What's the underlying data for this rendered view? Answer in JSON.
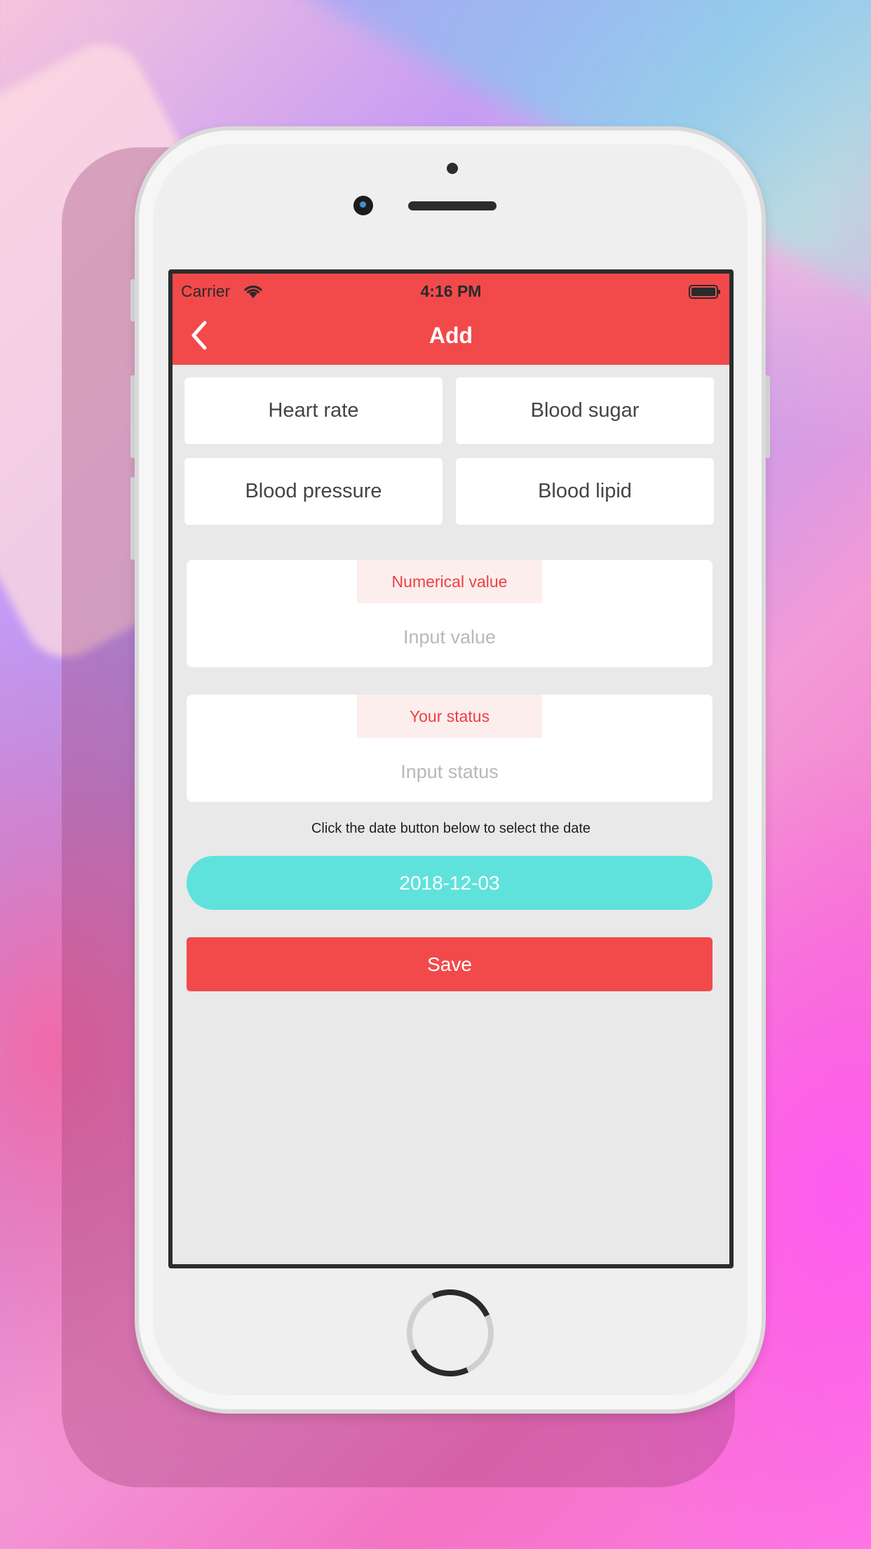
{
  "status_bar": {
    "carrier": "Carrier",
    "time": "4:16 PM",
    "wifi_icon": "wifi-icon",
    "battery_icon": "battery-icon"
  },
  "header": {
    "title": "Add",
    "back_icon": "chevron-left-icon",
    "color": "#f24a4b"
  },
  "types": [
    {
      "label": "Heart rate"
    },
    {
      "label": "Blood sugar"
    },
    {
      "label": "Blood pressure"
    },
    {
      "label": "Blood lipid"
    }
  ],
  "value_field": {
    "label": "Numerical value",
    "placeholder": "Input value",
    "value": ""
  },
  "status_field": {
    "label": "Your status",
    "placeholder": "Input status",
    "value": ""
  },
  "hint": "Click the date button below to select the date",
  "date_button": {
    "label": "2018-12-03",
    "color": "#60e2dc"
  },
  "save_button": {
    "label": "Save",
    "color": "#f24a4b"
  }
}
